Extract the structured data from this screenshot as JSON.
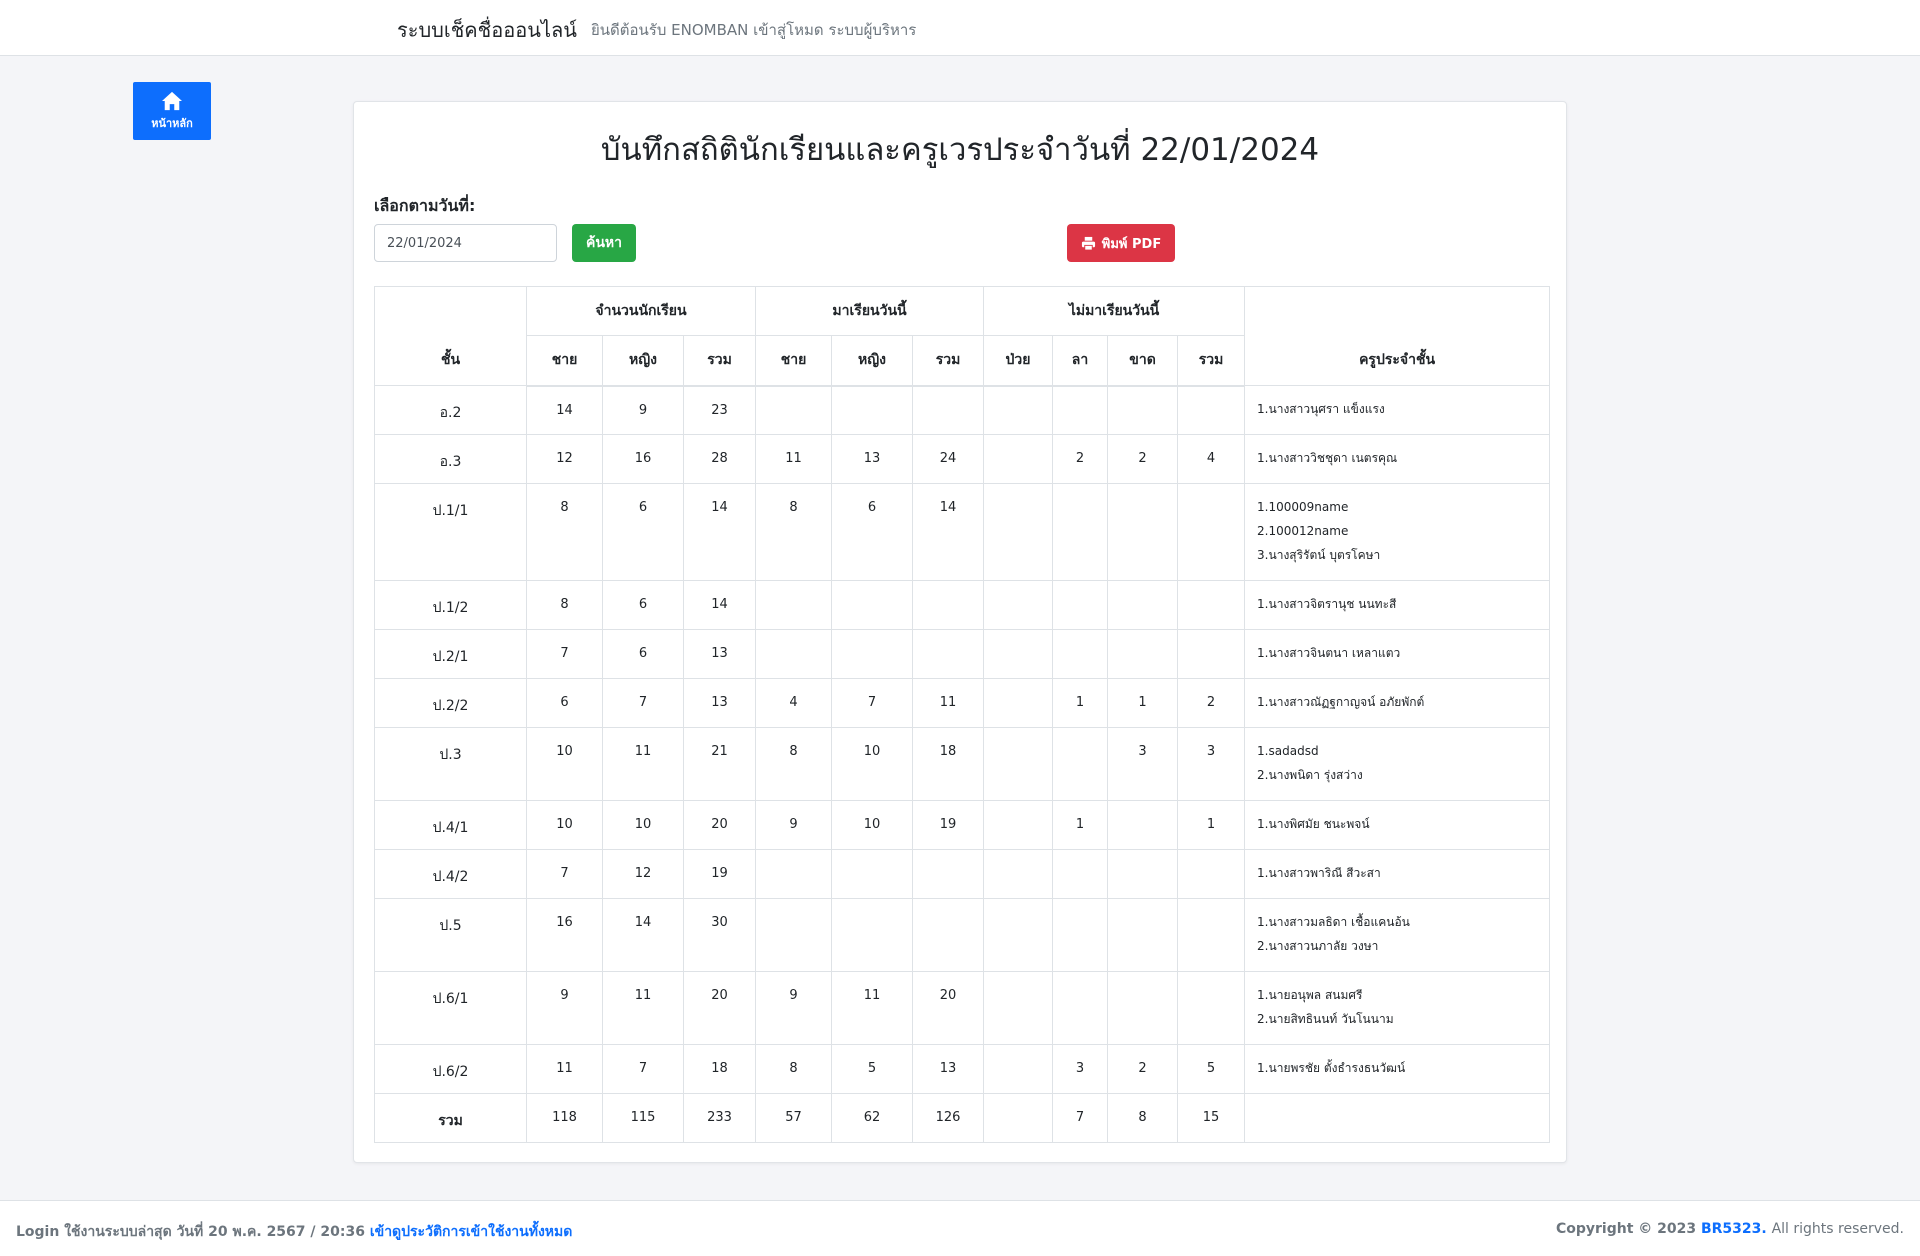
{
  "header": {
    "brand": "ระบบเช็คชื่อออนไลน์",
    "welcome": "ยินดีต้อนรับ ENOMBAN เข้าสู่โหมด ระบบผู้บริหาร"
  },
  "home_button": {
    "label": "หน้าหลัก",
    "icon": "home-icon"
  },
  "page": {
    "title": "บันทึกสถิตินักเรียนและครูเวรประจำวันที่ 22/01/2024",
    "date_label": "เลือกตามวันที่:",
    "date_value": "22/01/2024",
    "search_label": "ค้นหา",
    "pdf_label": "พิมพ์ PDF"
  },
  "table": {
    "headers": {
      "class": "ชั้น",
      "students": "จำนวนนักเรียน",
      "present": "มาเรียนวันนี้",
      "absent": "ไม่มาเรียนวันนี้",
      "teacher": "ครูประจำชั้น",
      "male": "ชาย",
      "female": "หญิง",
      "total": "รวม",
      "sick": "ป่วย",
      "leave": "ลา",
      "missing": "ขาด"
    },
    "rows": [
      {
        "cls": "อ.2",
        "s_m": "14",
        "s_f": "9",
        "s_t": "23",
        "p_m": "",
        "p_f": "",
        "p_t": "",
        "a_s": "",
        "a_l": "",
        "a_m": "",
        "a_t": "",
        "teachers": [
          "1.นางสาวนุศรา แข็งแรง"
        ]
      },
      {
        "cls": "อ.3",
        "s_m": "12",
        "s_f": "16",
        "s_t": "28",
        "p_m": "11",
        "p_f": "13",
        "p_t": "24",
        "a_s": "",
        "a_l": "2",
        "a_m": "2",
        "a_t": "4",
        "teachers": [
          "1.นางสาววิชชุดา เนตรคุณ"
        ]
      },
      {
        "cls": "ป.1/1",
        "s_m": "8",
        "s_f": "6",
        "s_t": "14",
        "p_m": "8",
        "p_f": "6",
        "p_t": "14",
        "a_s": "",
        "a_l": "",
        "a_m": "",
        "a_t": "",
        "teachers": [
          "1.100009name",
          "2.100012name",
          "3.นางสุริรัตน์ บุตรโคษา"
        ]
      },
      {
        "cls": "ป.1/2",
        "s_m": "8",
        "s_f": "6",
        "s_t": "14",
        "p_m": "",
        "p_f": "",
        "p_t": "",
        "a_s": "",
        "a_l": "",
        "a_m": "",
        "a_t": "",
        "teachers": [
          "1.นางสาวจิตรานุช นนทะสี"
        ]
      },
      {
        "cls": "ป.2/1",
        "s_m": "7",
        "s_f": "6",
        "s_t": "13",
        "p_m": "",
        "p_f": "",
        "p_t": "",
        "a_s": "",
        "a_l": "",
        "a_m": "",
        "a_t": "",
        "teachers": [
          "1.นางสาวจินตนา เหลาแตว"
        ]
      },
      {
        "cls": "ป.2/2",
        "s_m": "6",
        "s_f": "7",
        "s_t": "13",
        "p_m": "4",
        "p_f": "7",
        "p_t": "11",
        "a_s": "",
        "a_l": "1",
        "a_m": "1",
        "a_t": "2",
        "teachers": [
          "1.นางสาวณัฏฐกาญจน์ อภัยพักต์"
        ]
      },
      {
        "cls": "ป.3",
        "s_m": "10",
        "s_f": "11",
        "s_t": "21",
        "p_m": "8",
        "p_f": "10",
        "p_t": "18",
        "a_s": "",
        "a_l": "",
        "a_m": "3",
        "a_t": "3",
        "teachers": [
          "1.sadadsd",
          "2.นางพนิดา รุ่งสว่าง"
        ]
      },
      {
        "cls": "ป.4/1",
        "s_m": "10",
        "s_f": "10",
        "s_t": "20",
        "p_m": "9",
        "p_f": "10",
        "p_t": "19",
        "a_s": "",
        "a_l": "1",
        "a_m": "",
        "a_t": "1",
        "teachers": [
          "1.นางพิศมัย ชนะพจน์"
        ]
      },
      {
        "cls": "ป.4/2",
        "s_m": "7",
        "s_f": "12",
        "s_t": "19",
        "p_m": "",
        "p_f": "",
        "p_t": "",
        "a_s": "",
        "a_l": "",
        "a_m": "",
        "a_t": "",
        "teachers": [
          "1.นางสาวพาริณี สีวะสา"
        ]
      },
      {
        "cls": "ป.5",
        "s_m": "16",
        "s_f": "14",
        "s_t": "30",
        "p_m": "",
        "p_f": "",
        "p_t": "",
        "a_s": "",
        "a_l": "",
        "a_m": "",
        "a_t": "",
        "teachers": [
          "1.นางสาวมลธิดา เชื้อแคนอ้น",
          "2.นางสาวนภาลัย วงษา"
        ]
      },
      {
        "cls": "ป.6/1",
        "s_m": "9",
        "s_f": "11",
        "s_t": "20",
        "p_m": "9",
        "p_f": "11",
        "p_t": "20",
        "a_s": "",
        "a_l": "",
        "a_m": "",
        "a_t": "",
        "teachers": [
          "1.นายอนุพล สนมศรี",
          "2.นายสิทธินนท์ วันโนนาม"
        ]
      },
      {
        "cls": "ป.6/2",
        "s_m": "11",
        "s_f": "7",
        "s_t": "18",
        "p_m": "8",
        "p_f": "5",
        "p_t": "13",
        "a_s": "",
        "a_l": "3",
        "a_m": "2",
        "a_t": "5",
        "teachers": [
          "1.นายพรชัย ตั้งธำรงธนวัฒน์"
        ]
      }
    ],
    "total": {
      "cls": "รวม",
      "s_m": "118",
      "s_f": "115",
      "s_t": "233",
      "p_m": "57",
      "p_f": "62",
      "p_t": "126",
      "a_s": "",
      "a_l": "7",
      "a_m": "8",
      "a_t": "15"
    }
  },
  "footer": {
    "login_text": "Login ใช้งานระบบล่าสุด วันที่ 20 พ.ค. 2567 / 20:36",
    "history_link": "เข้าดูประวัติการเข้าใช้งานทั้งหมด",
    "copyright": "Copyright © 2023",
    "company_link": "BR5323.",
    "rights": "All rights reserved."
  }
}
